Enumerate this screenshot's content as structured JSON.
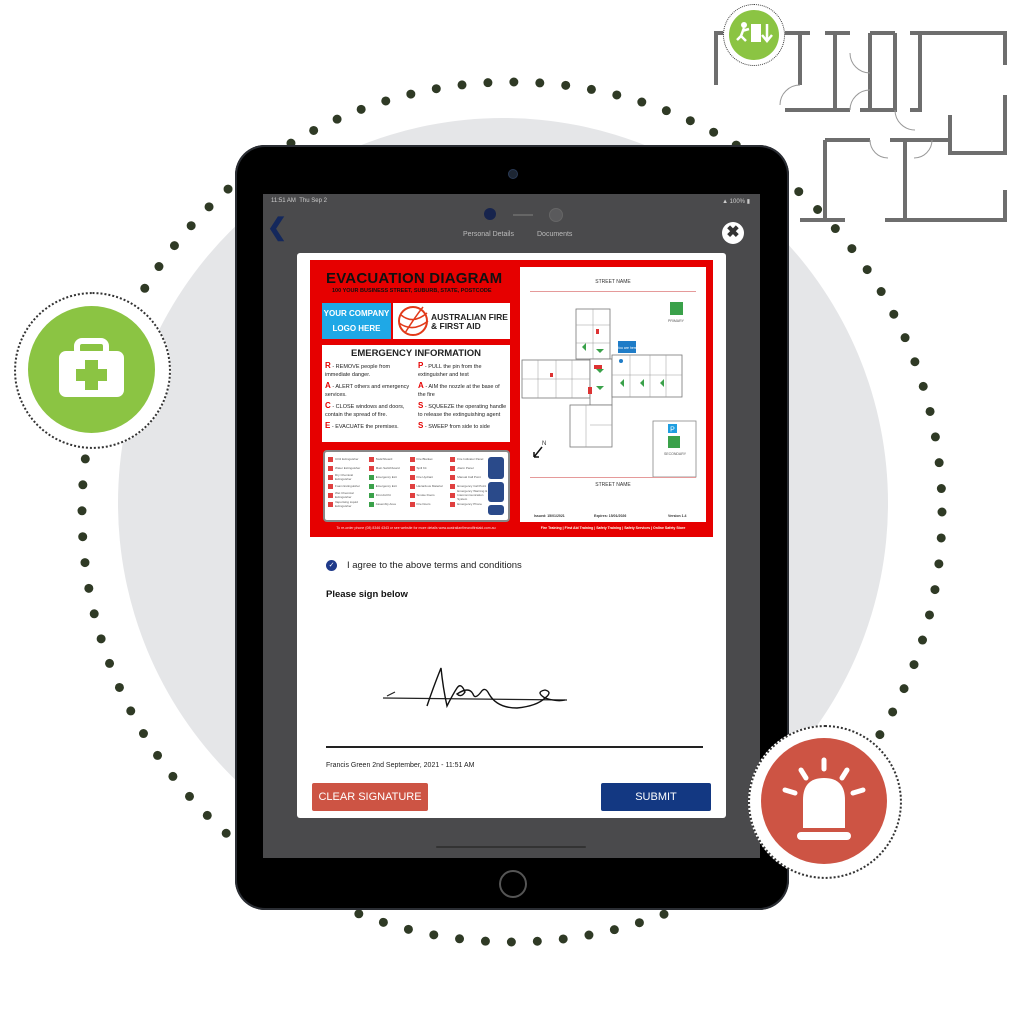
{
  "status_bar": {
    "time": "11:51 AM",
    "date": "Thu Sep 2",
    "battery": "100%"
  },
  "nav": {
    "back_icon": "chevron-left-icon",
    "steps": [
      {
        "label": "Personal Details",
        "state": "complete"
      },
      {
        "label": "Documents",
        "state": "pending"
      }
    ],
    "close_icon": "close-icon"
  },
  "poster": {
    "title": "EVACUATION DIAGRAM",
    "address": "100 YOUR BUSINESS STREET, SUBURB, STATE, POSTCODE",
    "logo_placeholder_line1": "YOUR COMPANY",
    "logo_placeholder_line2": "LOGO HERE",
    "brand_line1": "AUSTRALIAN FIRE",
    "brand_line2": "& FIRST AID",
    "emergency_title": "EMERGENCY INFORMATION",
    "race": [
      {
        "letter": "R",
        "text": "- REMOVE people from immediate danger."
      },
      {
        "letter": "A",
        "text": "- ALERT others and emergency services."
      },
      {
        "letter": "C",
        "text": "- CLOSE windows and doors, contain the spread of fire."
      },
      {
        "letter": "E",
        "text": "- EVACUATE the premises."
      }
    ],
    "pass": [
      {
        "letter": "P",
        "text": "- PULL the pin from the extinguisher and test"
      },
      {
        "letter": "A",
        "text": "- AIM the nozzle at the base of the fire"
      },
      {
        "letter": "S",
        "text": "- SQUEEZE the operating handle to release the extinguishing agent"
      },
      {
        "letter": "S",
        "text": "- SWEEP from side to side"
      }
    ],
    "legend_items": [
      "CO2 Extinguisher",
      "Switchboard",
      "Fire Blanket",
      "Fire Indicator Panel",
      "Water Extinguisher",
      "Main Switchboard",
      "Spill Kit",
      "Alarm Panel",
      "Dry Chemical Extinguisher",
      "Emergency Exit",
      "Fire Hydrant",
      "Manual Call Point",
      "Foam Extinguisher",
      "Emergency Exit",
      "Hazardous Material",
      "Emergency Call Point",
      "Wet Chemical Extinguisher",
      "First Aid Kit",
      "Smoke Doors",
      "Emergency Warning & Intercommunication System",
      "Vaporising Liquid Extinguisher",
      "Assembly Area",
      "Fire Doors",
      "Emergency Phone"
    ],
    "emergency_number_1": "000",
    "emergency_number_2": "106",
    "footer_left": "To re-order phone (08) 8346 4343 or see website for more details www.australianfireandfirstaid.com.au",
    "map": {
      "street_top": "STREET NAME",
      "street_bottom": "STREET NAME",
      "you_are_here": "You are here",
      "primary_label": "PRIMARY",
      "secondary_label": "SECONDARY",
      "parking_label": "P",
      "north_label": "N",
      "issued": "Issued: 15/01/2021",
      "expires": "Expires: 15/01/2026",
      "version": "Version 1.4"
    },
    "footer_right": "Fire Training | First Aid Training | Safety Training | Safety Services | Online Safety Store"
  },
  "form": {
    "agree_checked": true,
    "agree_label": "I agree to the above terms and conditions",
    "sign_label": "Please sign below",
    "signature_meta": "Francis Green 2nd September, 2021 - 11:51 AM",
    "clear_label": "CLEAR SIGNATURE",
    "submit_label": "SUBMIT"
  },
  "decor": {
    "badges": [
      {
        "icon": "first-aid-kit-icon",
        "color": "#8bc443"
      },
      {
        "icon": "alarm-siren-icon",
        "color": "#cd5444"
      },
      {
        "icon": "emergency-exit-icon",
        "color": "#8bc443"
      }
    ],
    "accent_navy": "#133882",
    "accent_red": "#cd5444",
    "poster_red": "#e60000"
  }
}
